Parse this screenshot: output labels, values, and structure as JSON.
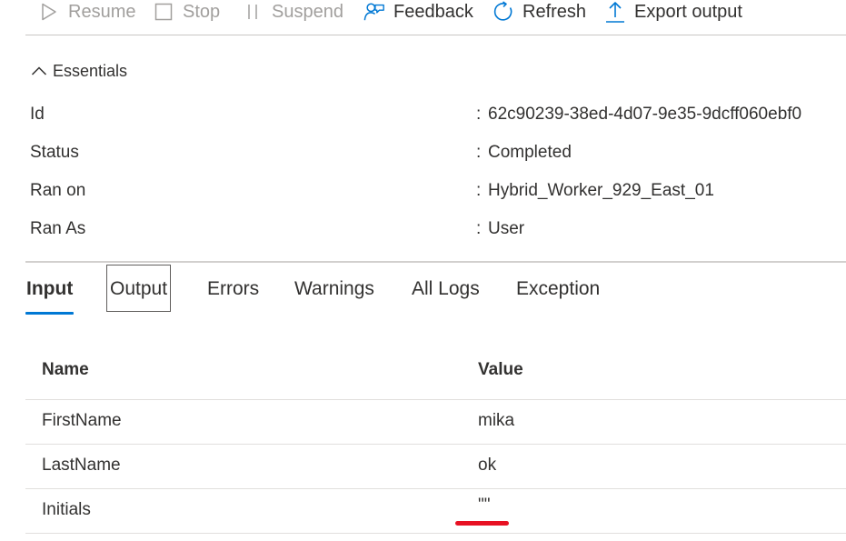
{
  "toolbar": {
    "resume_label": "Resume",
    "stop_label": "Stop",
    "suspend_label": "Suspend",
    "feedback_label": "Feedback",
    "refresh_label": "Refresh",
    "export_label": "Export output"
  },
  "essentials": {
    "label": "Essentials",
    "separator": ":",
    "id_label": "Id",
    "id_value": "62c90239-38ed-4d07-9e35-9dcff060ebf0",
    "status_label": "Status",
    "status_value": "Completed",
    "ran_on_label": "Ran on",
    "ran_on_value": "Hybrid_Worker_929_East_01",
    "ran_as_label": "Ran As",
    "ran_as_value": "User"
  },
  "tabs": {
    "input": "Input",
    "output": "Output",
    "errors": "Errors",
    "warnings": "Warnings",
    "all_logs": "All Logs",
    "exception": "Exception"
  },
  "table": {
    "header_name": "Name",
    "header_value": "Value",
    "rows": [
      {
        "name": "FirstName",
        "value": "mika"
      },
      {
        "name": "LastName",
        "value": "ok"
      },
      {
        "name": "Initials",
        "value": "\"\""
      }
    ]
  },
  "colors": {
    "accent": "#0078d4",
    "annotation_red": "#e81123",
    "disabled_text": "#a19f9d"
  },
  "icons": {
    "resume": "play-icon",
    "stop": "stop-icon",
    "suspend": "pause-icon",
    "feedback": "feedback-person-icon",
    "refresh": "refresh-icon",
    "export": "upload-icon",
    "essentials": "chevron-up-icon"
  }
}
